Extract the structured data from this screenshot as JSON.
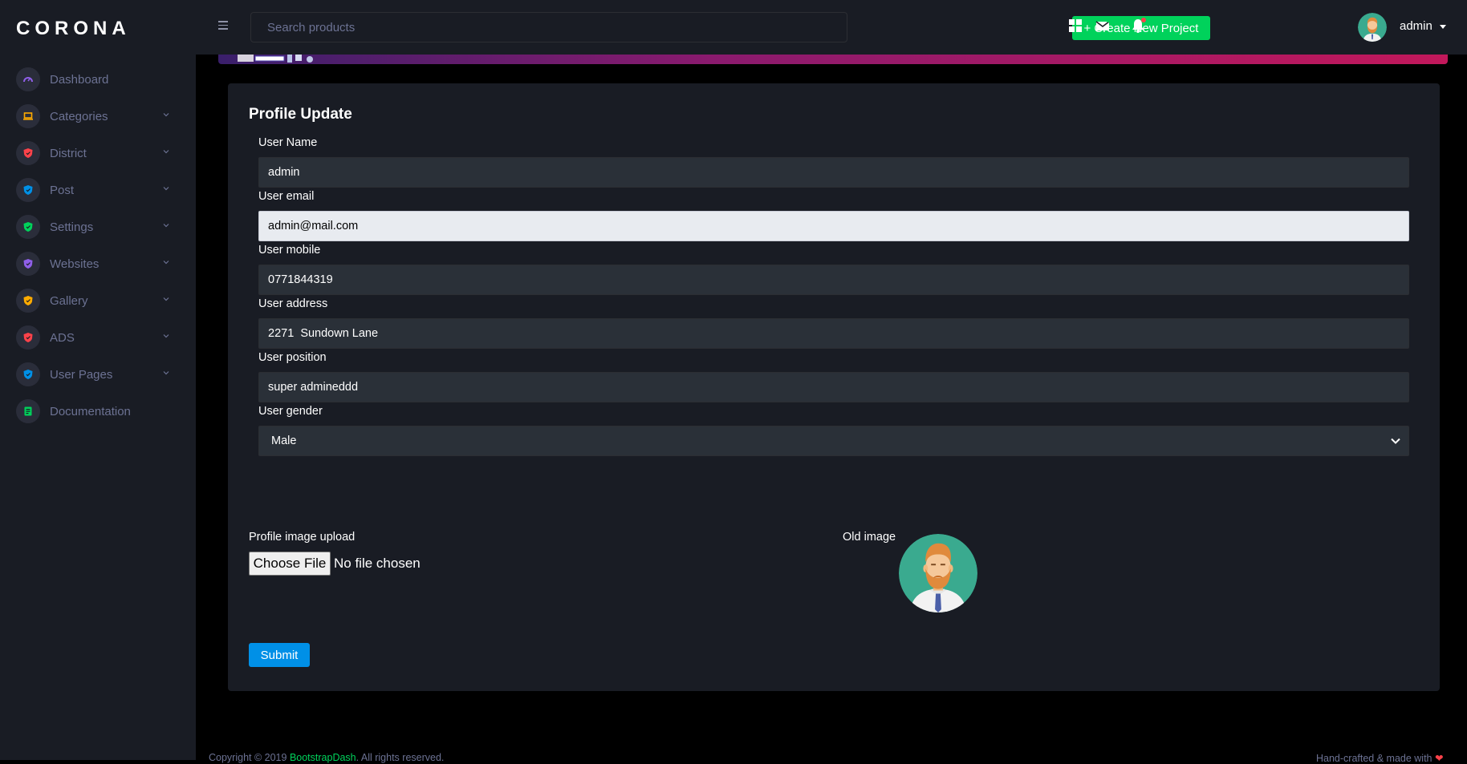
{
  "brand": "CORONA",
  "sidebar": {
    "items": [
      {
        "label": "Dashboard",
        "icon": "speedometer-icon",
        "color": "#8f5fe8",
        "has_chevron": false
      },
      {
        "label": "Categories",
        "icon": "laptop-icon",
        "color": "#ffab00",
        "has_chevron": true
      },
      {
        "label": "District",
        "icon": "shield-icon",
        "color": "#fc424a",
        "has_chevron": true
      },
      {
        "label": "Post",
        "icon": "shield-icon",
        "color": "#0090e7",
        "has_chevron": true
      },
      {
        "label": "Settings",
        "icon": "shield-icon",
        "color": "#00d25b",
        "has_chevron": true
      },
      {
        "label": "Websites",
        "icon": "shield-icon",
        "color": "#8f5fe8",
        "has_chevron": true
      },
      {
        "label": "Gallery",
        "icon": "shield-icon",
        "color": "#ffab00",
        "has_chevron": true
      },
      {
        "label": "ADS",
        "icon": "shield-icon",
        "color": "#fc424a",
        "has_chevron": true
      },
      {
        "label": "User Pages",
        "icon": "shield-icon",
        "color": "#0090e7",
        "has_chevron": true
      },
      {
        "label": "Documentation",
        "icon": "document-icon",
        "color": "#00d25b",
        "has_chevron": false
      }
    ]
  },
  "topbar": {
    "search_placeholder": "Search products",
    "create_label": "+ Create New Project",
    "user_name": "admin"
  },
  "form": {
    "title": "Profile Update",
    "username_label": "User Name",
    "username_value": "admin",
    "email_label": "User email",
    "email_value": "admin@mail.com",
    "mobile_label": "User mobile",
    "mobile_value": "0771844319",
    "address_label": "User address",
    "address_value": "2271  Sundown Lane",
    "position_label": "User position",
    "position_value": "super admineddd",
    "gender_label": "User gender",
    "gender_value": "Male",
    "upload_label": "Profile image upload",
    "file_button": "Choose File",
    "file_status": "No file chosen",
    "old_image_label": "Old image",
    "submit_label": "Submit"
  },
  "footer": {
    "copyright_prefix": "Copyright © 2019 ",
    "copyright_link": "BootstrapDash",
    "copyright_suffix": ". All rights reserved.",
    "right_text": "Hand-crafted & made with"
  },
  "colors": {
    "accent_green": "#00d25b",
    "accent_blue": "#0090e7",
    "sidebar_bg": "#191c24",
    "page_bg": "#000000"
  }
}
